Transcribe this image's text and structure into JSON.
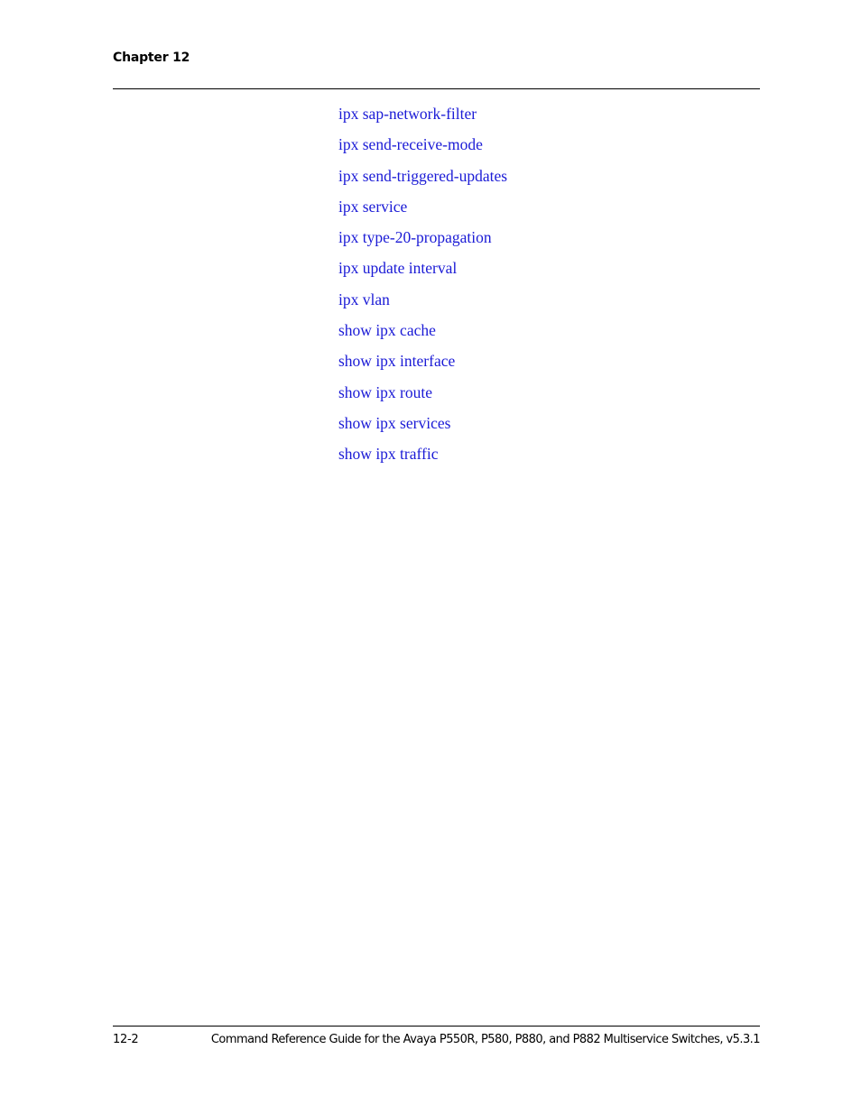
{
  "header": {
    "chapter": "Chapter 12"
  },
  "links": [
    {
      "label": "ipx sap-network-filter"
    },
    {
      "label": "ipx send-receive-mode"
    },
    {
      "label": "ipx send-triggered-updates"
    },
    {
      "label": "ipx service"
    },
    {
      "label": "ipx type-20-propagation"
    },
    {
      "label": "ipx update interval"
    },
    {
      "label": "ipx vlan"
    },
    {
      "label": "show ipx cache"
    },
    {
      "label": "show ipx interface"
    },
    {
      "label": "show ipx route"
    },
    {
      "label": "show ipx services"
    },
    {
      "label": "show ipx traffic"
    }
  ],
  "footer": {
    "page_number": "12-2",
    "doc_title": "Command Reference Guide for the Avaya P550R, P580, P880, and P882 Multiservice Switches, v5.3.1"
  },
  "colors": {
    "link": "#1b1bd6",
    "text": "#000000"
  }
}
